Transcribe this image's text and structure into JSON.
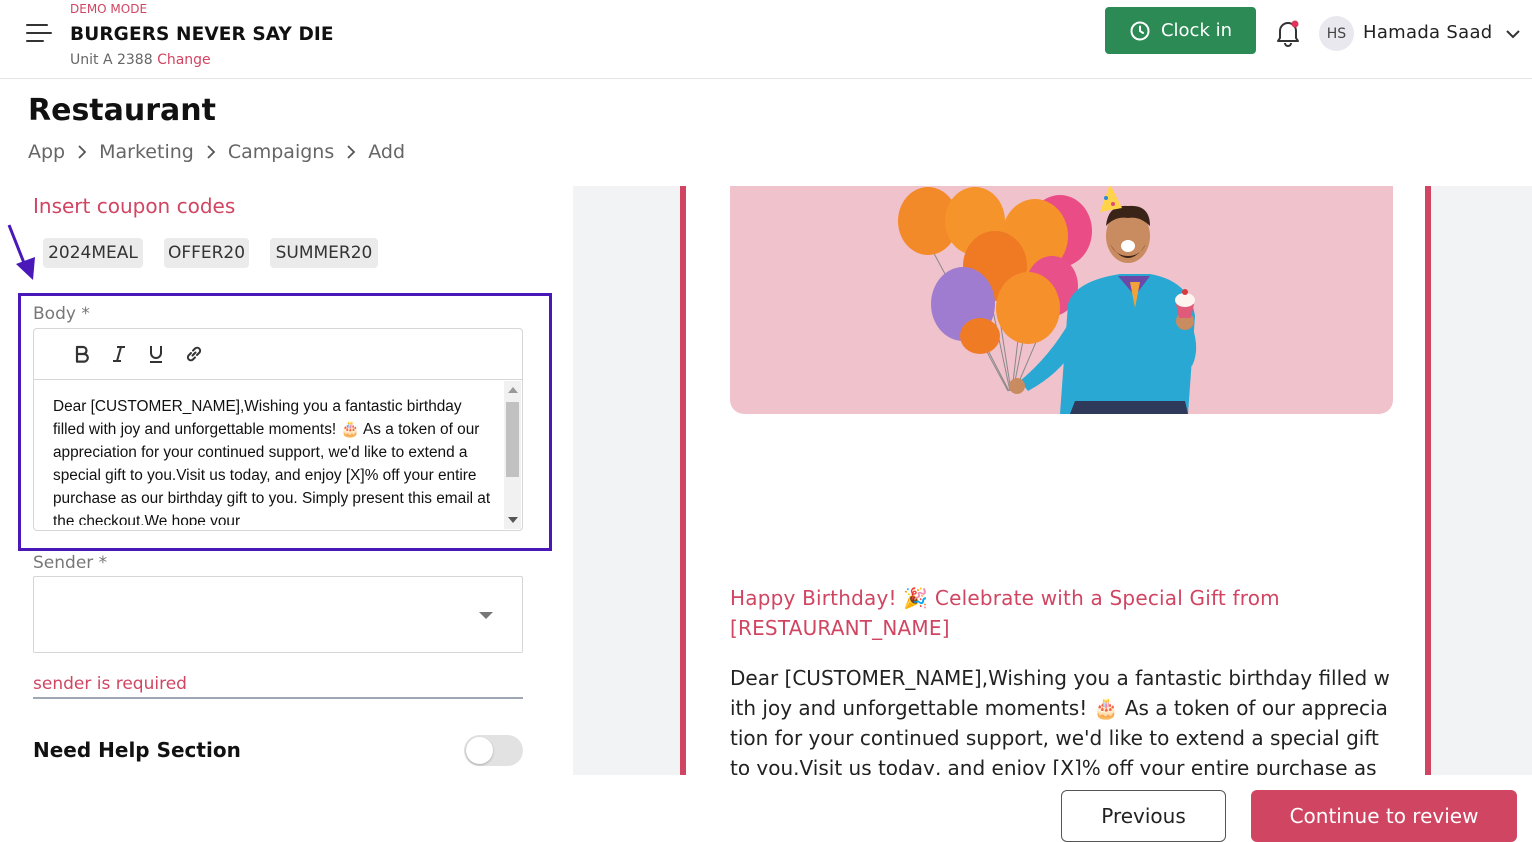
{
  "header": {
    "mode_label": "DEMO MODE",
    "business_name": "BURGERS NEVER SAY DIE",
    "unit_label": "Unit A 2388",
    "change_link": "Change",
    "clock_in_label": "Clock in",
    "user_initials": "HS",
    "user_name": "Hamada Saad"
  },
  "page": {
    "title": "Restaurant",
    "breadcrumb": [
      "App",
      "Marketing",
      "Campaigns",
      "Add"
    ]
  },
  "form": {
    "coupon_title": "Insert coupon codes",
    "coupons": [
      "2024MEAL",
      "OFFER20",
      "SUMMER20"
    ],
    "body_label": "Body *",
    "body_text": "Dear [CUSTOMER_NAME],Wishing you a fantastic birthday filled with joy and unforgettable moments! 🎂 As a token of our appreciation for your continued support, we'd like to extend a special gift to you.Visit us today, and enjoy [X]% off your entire purchase as our birthday gift to you. Simply present this email at the checkout.We hope your",
    "sender_label": "Sender *",
    "sender_value": "",
    "sender_error": "sender is required",
    "help_title": "Need Help Section",
    "help_enabled": false
  },
  "preview": {
    "subject": "Happy Birthday! 🎉 Celebrate with a Special Gift from [RESTAURANT_NAME]",
    "body": "Dear [CUSTOMER_NAME],Wishing you a fantastic birthday filled with joy and unforgettable moments! 🎂 As a token of our appreciation for your continued support, we'd like to extend a special gift to you.Visit us today, and enjoy [X]% off your entire purchase as our"
  },
  "footer": {
    "previous_label": "Previous",
    "continue_label": "Continue to review"
  },
  "colors": {
    "brand": "#d04562",
    "clock_in": "#2c8a55",
    "highlight": "#4a18b8",
    "hero_bg": "#f0c2cc"
  },
  "icons": [
    "menu-icon",
    "clock-icon",
    "bell-icon",
    "chevron-down-icon",
    "chevron-right-icon",
    "bold-icon",
    "italic-icon",
    "underline-icon",
    "link-icon",
    "annotation-arrow-icon"
  ]
}
